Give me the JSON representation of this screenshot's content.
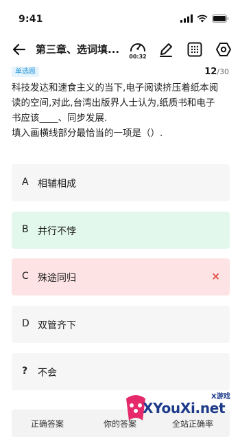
{
  "status_bar": {
    "time": "9:41"
  },
  "header": {
    "title": "第三章、选词填...",
    "timer": "00:32"
  },
  "question": {
    "type_badge": "单选题",
    "current": "12",
    "total": "/30",
    "text_line1": "科技发达和速食主义的当下,电子阅读挤压着纸本阅",
    "text_line2": "读的空间,对此,台湾出版界人士认为,纸质书和电子",
    "text_line3": "书应该____、同步发展.",
    "text_line4": "填入画横线部分最恰当的一项是（）."
  },
  "options": [
    {
      "letter": "A",
      "text": "相辅相成",
      "state": "normal"
    },
    {
      "letter": "B",
      "text": "并行不悖",
      "state": "correct"
    },
    {
      "letter": "C",
      "text": "殊途同归",
      "state": "wrong",
      "mark": "×"
    },
    {
      "letter": "D",
      "text": "双管齐下",
      "state": "normal"
    },
    {
      "letter": "?",
      "text": "不会",
      "state": "normal"
    }
  ],
  "bottom_bar": {
    "correct_answer": "正确答案",
    "your_answer": "你的答案",
    "accuracy": "全站正确率"
  },
  "watermark": {
    "text": "XYouXi.net",
    "small": "X游戏"
  },
  "colors": {
    "correct_bg": "#e2f8ec",
    "wrong_bg": "#fde3e3",
    "badge_bg": "#e6f4fd",
    "badge_text": "#2a9ad8",
    "wrong_mark": "#e3483f"
  }
}
